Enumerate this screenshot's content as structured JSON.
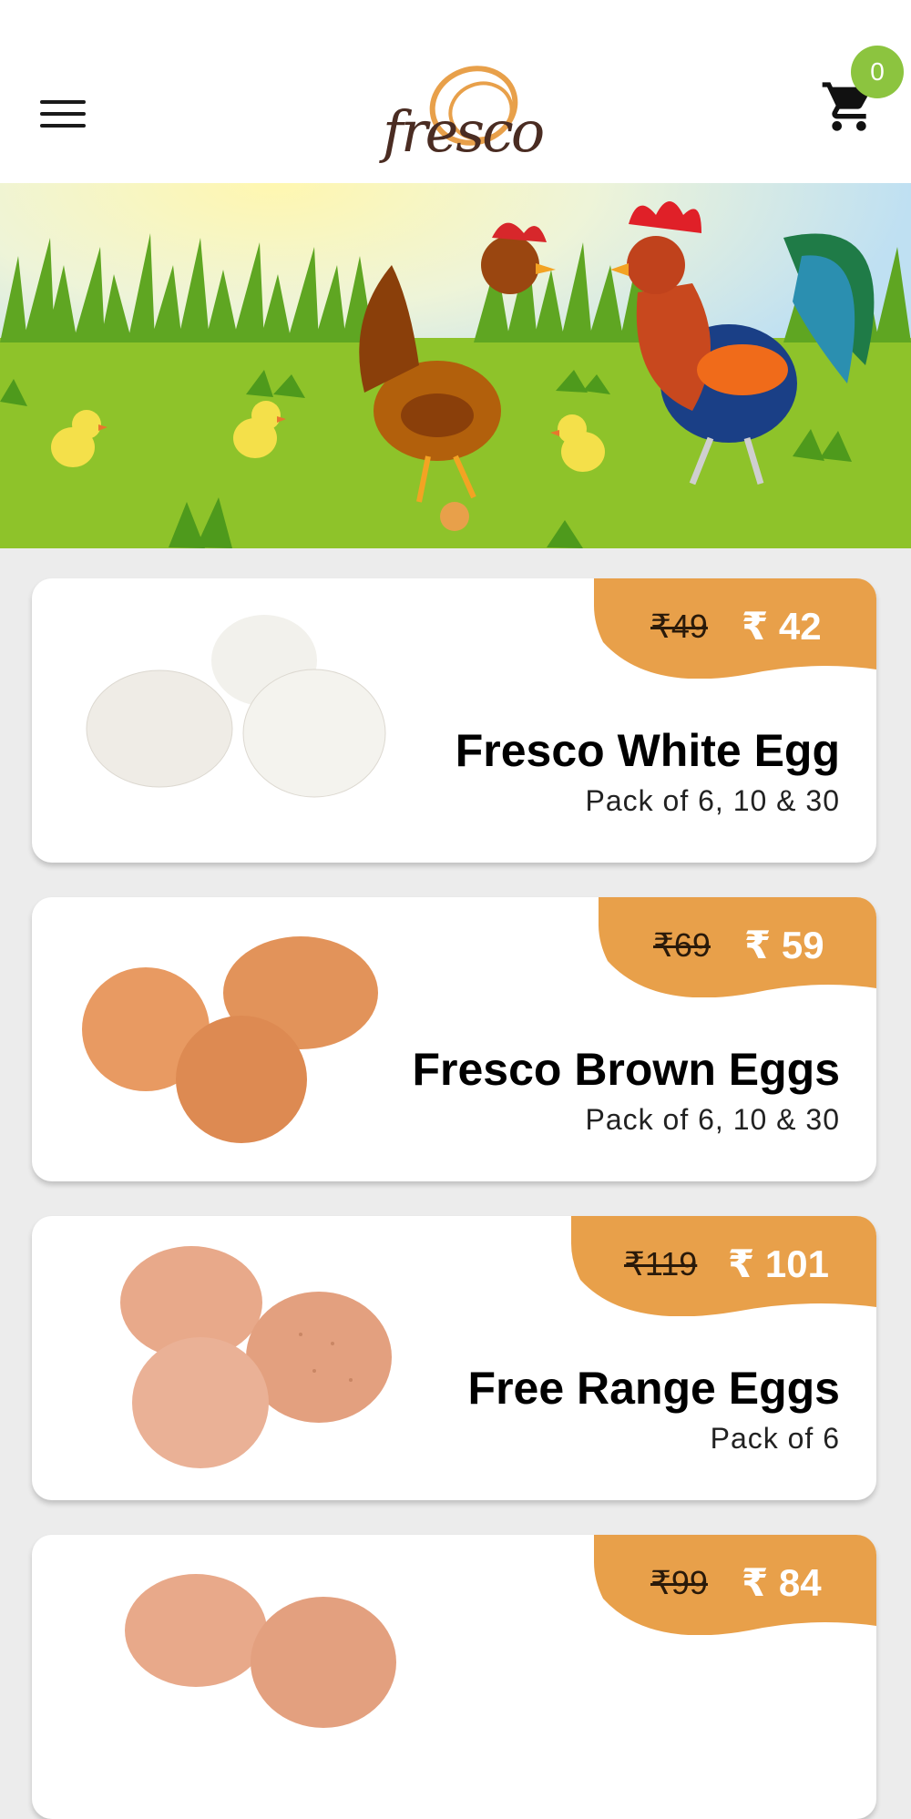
{
  "header": {
    "brand": "fresco",
    "cart_count": "0"
  },
  "banner": {
    "slide_count": 1,
    "active_slide": 1
  },
  "colors": {
    "accent_orange": "#E8A04A",
    "cart_badge_green": "#8CC43F",
    "background": "#ECECEC"
  },
  "products": [
    {
      "name": "Fresco White Egg",
      "pack": "Pack of 6, 10 & 30",
      "old_price": "₹49",
      "price": "₹ 42",
      "egg_color": "white"
    },
    {
      "name": "Fresco Brown Eggs",
      "pack": "Pack of 6, 10 & 30",
      "old_price": "₹69",
      "price": "₹ 59",
      "egg_color": "brown"
    },
    {
      "name": "Free Range Eggs",
      "pack": "Pack of 6",
      "old_price": "₹119",
      "price": "₹ 101",
      "egg_color": "speckled"
    },
    {
      "name": "",
      "pack": "",
      "old_price": "₹99",
      "price": "₹ 84",
      "egg_color": "speckled"
    }
  ]
}
